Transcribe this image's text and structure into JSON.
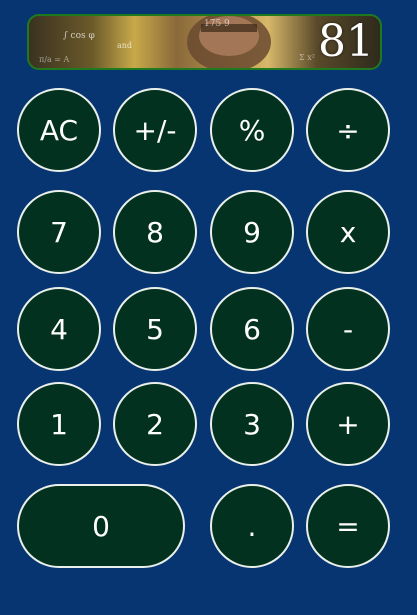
{
  "display": {
    "value": "81",
    "image_description": "man with floating math equations (meme background)"
  },
  "keys": {
    "ac": "AC",
    "sign": "+/-",
    "percent": "%",
    "divide": "÷",
    "seven": "7",
    "eight": "8",
    "nine": "9",
    "multiply": "x",
    "four": "4",
    "five": "5",
    "six": "6",
    "subtract": "-",
    "one": "1",
    "two": "2",
    "three": "3",
    "add": "+",
    "zero": "0",
    "decimal": ".",
    "equals": "="
  },
  "colors": {
    "background": "#073572",
    "key_fill": "#02311f",
    "key_border": "#e9efe9",
    "display_border": "#1f7a1f"
  }
}
